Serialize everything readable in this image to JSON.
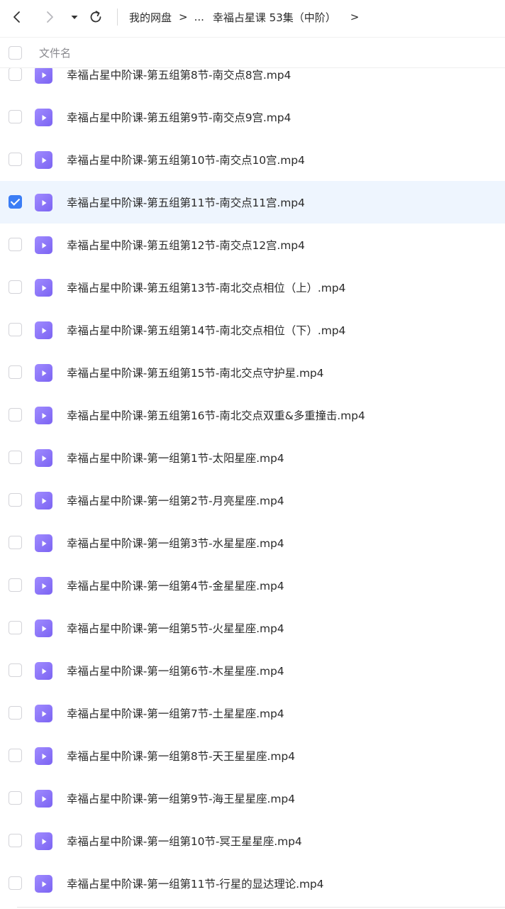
{
  "navbar": {
    "breadcrumb": {
      "root": "我的网盘",
      "separator": ">",
      "ellipsis": "...",
      "current": "幸福占星课 53集（中阶）",
      "next": ">"
    }
  },
  "header": {
    "column_name": "文件名"
  },
  "colors": {
    "accent": "#3b7df5",
    "selected_row": "#eef5fe",
    "video_icon": "#7b63f2"
  },
  "files": [
    {
      "name": "幸福占星中阶课-第五组第8节-南交点8宫.mp4",
      "icon": "video-file-icon",
      "selected": false
    },
    {
      "name": "幸福占星中阶课-第五组第9节-南交点9宫.mp4",
      "icon": "video-file-icon",
      "selected": false
    },
    {
      "name": "幸福占星中阶课-第五组第10节-南交点10宫.mp4",
      "icon": "video-file-icon",
      "selected": false
    },
    {
      "name": "幸福占星中阶课-第五组第11节-南交点11宫.mp4",
      "icon": "video-file-icon",
      "selected": true
    },
    {
      "name": "幸福占星中阶课-第五组第12节-南交点12宫.mp4",
      "icon": "video-file-icon",
      "selected": false
    },
    {
      "name": "幸福占星中阶课-第五组第13节-南北交点相位（上）.mp4",
      "icon": "video-file-icon",
      "selected": false
    },
    {
      "name": "幸福占星中阶课-第五组第14节-南北交点相位（下）.mp4",
      "icon": "video-file-icon",
      "selected": false
    },
    {
      "name": "幸福占星中阶课-第五组第15节-南北交点守护星.mp4",
      "icon": "video-file-icon",
      "selected": false
    },
    {
      "name": "幸福占星中阶课-第五组第16节-南北交点双重&多重撞击.mp4",
      "icon": "video-file-icon",
      "selected": false
    },
    {
      "name": "幸福占星中阶课-第一组第1节-太阳星座.mp4",
      "icon": "video-file-icon",
      "selected": false
    },
    {
      "name": "幸福占星中阶课-第一组第2节-月亮星座.mp4",
      "icon": "video-file-icon",
      "selected": false
    },
    {
      "name": "幸福占星中阶课-第一组第3节-水星星座.mp4",
      "icon": "video-file-icon",
      "selected": false
    },
    {
      "name": "幸福占星中阶课-第一组第4节-金星星座.mp4",
      "icon": "video-file-icon",
      "selected": false
    },
    {
      "name": "幸福占星中阶课-第一组第5节-火星星座.mp4",
      "icon": "video-file-icon",
      "selected": false
    },
    {
      "name": "幸福占星中阶课-第一组第6节-木星星座.mp4",
      "icon": "video-file-icon",
      "selected": false
    },
    {
      "name": "幸福占星中阶课-第一组第7节-土星星座.mp4",
      "icon": "video-file-icon",
      "selected": false
    },
    {
      "name": "幸福占星中阶课-第一组第8节-天王星星座.mp4",
      "icon": "video-file-icon",
      "selected": false
    },
    {
      "name": "幸福占星中阶课-第一组第9节-海王星星座.mp4",
      "icon": "video-file-icon",
      "selected": false
    },
    {
      "name": "幸福占星中阶课-第一组第10节-冥王星星座.mp4",
      "icon": "video-file-icon",
      "selected": false
    },
    {
      "name": "幸福占星中阶课-第一组第11节-行星的显达理论.mp4",
      "icon": "video-file-icon",
      "selected": false
    }
  ]
}
